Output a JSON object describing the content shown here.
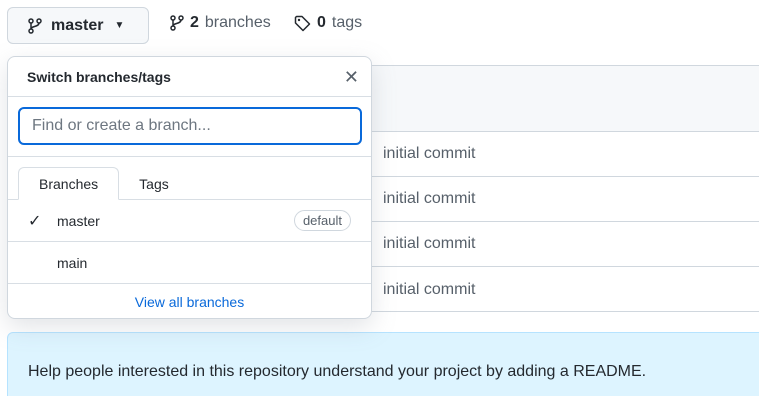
{
  "branch_selector": {
    "current": "master",
    "icon": "branch-icon"
  },
  "counters": {
    "branches_count": "2",
    "branches_label": "branches",
    "tags_count": "0",
    "tags_label": "tags"
  },
  "dropdown": {
    "title": "Switch branches/tags",
    "search_placeholder": "Find or create a branch...",
    "tabs": [
      {
        "label": "Branches",
        "active": true
      },
      {
        "label": "Tags",
        "active": false
      }
    ],
    "items": [
      {
        "name": "master",
        "selected": true,
        "badge": "default"
      },
      {
        "name": "main",
        "selected": false
      }
    ],
    "view_all": "View all branches"
  },
  "files": [
    {
      "message": "initial commit"
    },
    {
      "message": "initial commit"
    },
    {
      "message": "initial commit"
    },
    {
      "message": "initial commit"
    }
  ],
  "readme_prompt": "Help people interested in this repository understand your project by adding a README."
}
